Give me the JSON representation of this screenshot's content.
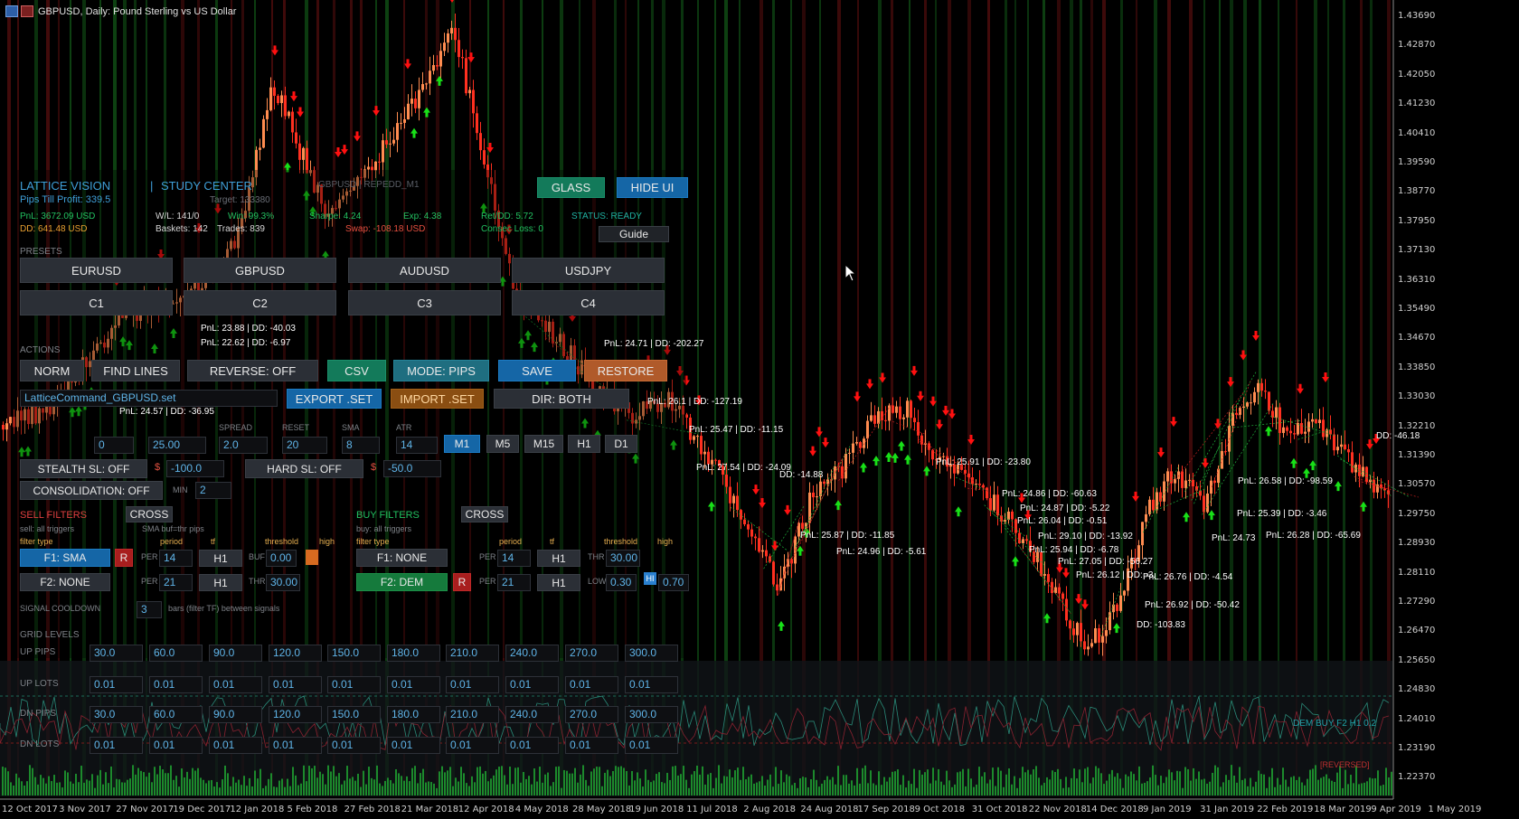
{
  "window": {
    "title": "GBPUSD, Daily:  Pound Sterling vs US Dollar"
  },
  "panel": {
    "brand": "LATTICE VISION",
    "separator": "|",
    "study_center": "STUDY CENTER",
    "symbol_tag": "GBPUSD | REPEDD_M1",
    "pips_till_profit": "Pips Till Profit: 339.5",
    "target": "Target: 133380",
    "stats": {
      "pnl": "PnL: 3672.09 USD",
      "dd": "DD: 641.48 USD",
      "wl": "W/L: 141/0",
      "baskets": "Baskets: 142",
      "trades": "Trades: 839",
      "win": "Win: 99.3%",
      "sharpe": "Sharpe: 4.24",
      "swap": "Swap: -108.18 USD",
      "exp": "Exp: 4.38",
      "ret_dd": "Ret/DD: 5.72",
      "consec_loss": "Consec Loss: 0",
      "status": "STATUS: READY"
    },
    "glass_label": "GLASS",
    "hide_ui_label": "HIDE UI",
    "guide_label": "Guide",
    "presets_title": "PRESETS",
    "presets": [
      "EURUSD",
      "GBPUSD",
      "AUDUSD",
      "USDJPY",
      "C1",
      "C2",
      "C3",
      "C4"
    ],
    "actions_title": "ACTIONS",
    "actions": {
      "norm": "NORM",
      "find_lines": "FIND LINES",
      "reverse": "REVERSE: OFF",
      "csv": "CSV",
      "mode": "MODE: PIPS",
      "save": "SAVE",
      "restore": "RESTORE",
      "file_value": "LatticeCommand_GBPUSD.set",
      "export": "EXPORT .SET",
      "import": "IMPORT .SET",
      "dir": "DIR: BOTH"
    },
    "params": {
      "spread_label": "SPREAD",
      "reset_label": "RESET",
      "sma_label": "SMA",
      "atr_label": "ATR",
      "f0": "0",
      "f1": "25.00",
      "spread": "2.0",
      "reset": "20",
      "sma": "8",
      "atr": "14"
    },
    "timeframes": [
      "M1",
      "M5",
      "M15",
      "H1",
      "D1"
    ],
    "timeframe_active": "M1",
    "stealth_sl": "STEALTH SL: OFF",
    "stealth_currency": "$",
    "stealth_value": "-100.0",
    "hard_sl": "HARD SL: OFF",
    "hard_currency": "$",
    "hard_value": "-50.0",
    "consolidation": "CONSOLIDATION: OFF",
    "min_label": "MIN",
    "min_value": "2",
    "sell_filters": {
      "title": "SELL FILTERS",
      "cross": "CROSS",
      "sub": "sell: all triggers",
      "sub2": "SMA buf=thr pips",
      "filter_type": "filter type",
      "period": "period",
      "tf": "tf",
      "threshold": "threshold",
      "high": "high",
      "f1": "F1: SMA",
      "r": "R",
      "per_label": "PER",
      "f1_period": "14",
      "f1_tf": "H1",
      "buf_label": "BUF",
      "f1_thr": "0.00",
      "f2": "F2: NONE",
      "f2_period": "21",
      "f2_tf": "H1",
      "thr_label": "THR",
      "f2_thr": "30.00"
    },
    "buy_filters": {
      "title": "BUY FILTERS",
      "cross": "CROSS",
      "sub": "buy: all triggers",
      "filter_type": "filter type",
      "period": "period",
      "tf": "tf",
      "threshold": "threshold",
      "high": "high",
      "f1": "F1: NONE",
      "per_label": "PER",
      "f1_period": "14",
      "f1_tf": "H1",
      "thr_label": "THR",
      "f1_thr": "30.00",
      "f2": "F2: DEM",
      "r": "R",
      "f2_period": "21",
      "f2_tf": "H1",
      "low_label": "LOW",
      "f2_low": "0.30",
      "hi_label": "HI",
      "f2_high": "0.70"
    },
    "cooldown_label": "SIGNAL COOLDOWN",
    "cooldown_value": "3",
    "cooldown_note": "bars (filter TF) between signals",
    "grid_title": "GRID LEVELS",
    "grid_rows": [
      {
        "label": "UP PIPS",
        "values": [
          "30.0",
          "60.0",
          "90.0",
          "120.0",
          "150.0",
          "180.0",
          "210.0",
          "240.0",
          "270.0",
          "300.0"
        ]
      },
      {
        "label": "UP LOTS",
        "values": [
          "0.01",
          "0.01",
          "0.01",
          "0.01",
          "0.01",
          "0.01",
          "0.01",
          "0.01",
          "0.01",
          "0.01"
        ]
      },
      {
        "label": "DN PIPS",
        "values": [
          "30.0",
          "60.0",
          "90.0",
          "120.0",
          "150.0",
          "180.0",
          "210.0",
          "240.0",
          "270.0",
          "300.0"
        ]
      },
      {
        "label": "DN LOTS",
        "values": [
          "0.01",
          "0.01",
          "0.01",
          "0.01",
          "0.01",
          "0.01",
          "0.01",
          "0.01",
          "0.01",
          "0.01"
        ]
      }
    ]
  },
  "chart_notes": [
    "PnL: 23.88 | DD: -40.03",
    "PnL: 22.62 | DD: -6.97",
    "PnL: 24.71 | DD: -202.27",
    "PnL: 26.1 | DD: -127.19",
    "PnL: 25.47 | DD: -11.15",
    "PnL: 27.54 | DD: -24.09",
    "DD: -14.88",
    "PnL: 25.91 | DD: -23.80",
    "PnL: 24.86 | DD: -60.63",
    "PnL: 24.87 | DD: -5.22",
    "PnL: 26.04 | DD: -0.51",
    "PnL: 25.87 | DD: -11.85",
    "PnL: 24.96 | DD: -5.61",
    "PnL: 29.10 | DD: -13.92",
    "PnL: 25.94 | DD: -6.78",
    "PnL: 27.05 | DD: -56.27",
    "PnL: 26.12 | DD: -3.",
    "PnL: 26.76 | DD: -4.54",
    "PnL: 26.92 | DD: -50.42",
    "DD: -103.83",
    "PnL: 24.73",
    "PnL: 26.28 | DD: -65.69",
    "PnL: 26.58 | DD: -98.59",
    "PnL: 25.39 | DD: -3.46",
    "DD: -46.18",
    "PnL: 24.57 | DD: -36.95"
  ],
  "indicator": {
    "label": "DEM BUY F2 H1 0.2",
    "reversed": "[REVERSED]"
  },
  "y_axis": [
    "1.43690",
    "1.42870",
    "1.42050",
    "1.41230",
    "1.40410",
    "1.39590",
    "1.38770",
    "1.37950",
    "1.37130",
    "1.36310",
    "1.35490",
    "1.34670",
    "1.33850",
    "1.33030",
    "1.32210",
    "1.31390",
    "1.30570",
    "1.29750",
    "1.28930",
    "1.28110",
    "1.27290",
    "1.26470",
    "1.25650",
    "1.24830",
    "1.24010",
    "1.23190",
    "1.22370"
  ],
  "x_axis": [
    "12 Oct 2017",
    "3 Nov 2017",
    "27 Nov 2017",
    "19 Dec 2017",
    "12 Jan 2018",
    "5 Feb 2018",
    "27 Feb 2018",
    "21 Mar 2018",
    "12 Apr 2018",
    "4 May 2018",
    "28 May 2018",
    "19 Jun 2018",
    "11 Jul 2018",
    "2 Aug 2018",
    "24 Aug 2018",
    "17 Sep 2018",
    "9 Oct 2018",
    "31 Oct 2018",
    "22 Nov 2018",
    "14 Dec 2018",
    "9 Jan 2019",
    "31 Jan 2019",
    "22 Feb 2019",
    "18 Mar 2019",
    "9 Apr 2019",
    "1 May 2019"
  ],
  "colors": {
    "bull": "#ff8c50",
    "bear": "#ff3020",
    "buy_arrow": "#18e018",
    "sell_arrow": "#ff1010",
    "accent_blue": "#1b7bc4",
    "accent_teal": "#1a8f6a"
  }
}
